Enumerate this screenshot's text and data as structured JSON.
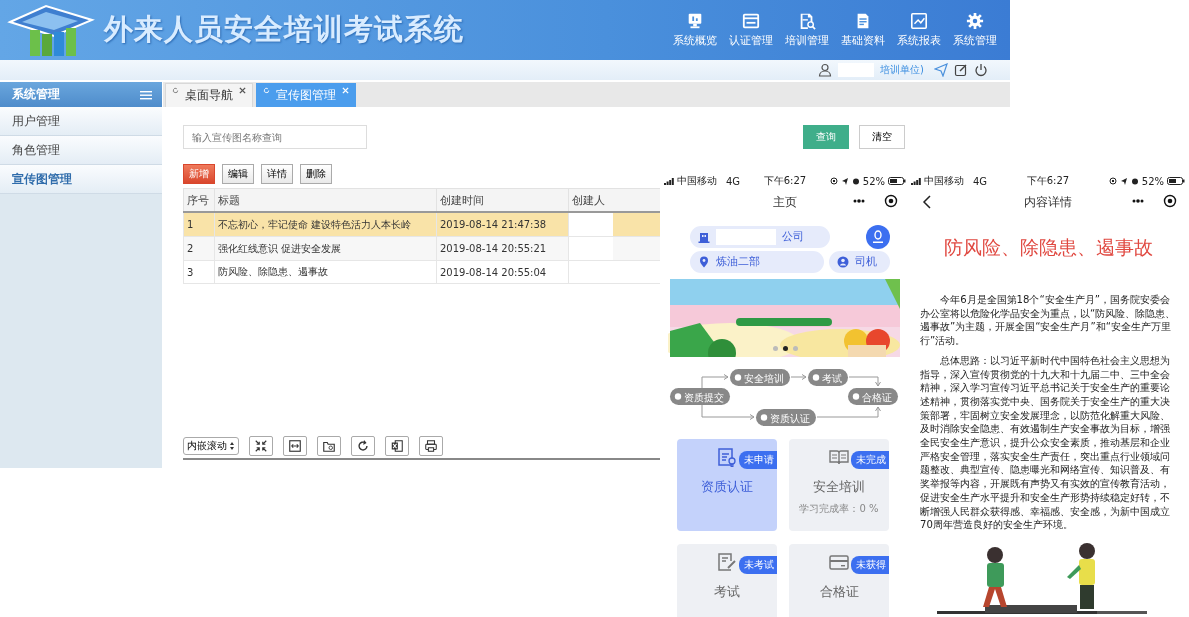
{
  "header": {
    "title": "外来人员安全培训考试系统",
    "nav": [
      {
        "label": "系统概览"
      },
      {
        "label": "认证管理"
      },
      {
        "label": "培训管理"
      },
      {
        "label": "基础资料"
      },
      {
        "label": "系统报表"
      },
      {
        "label": "系统管理"
      }
    ],
    "user_org": "培训单位)"
  },
  "sidebar": {
    "title": "系统管理",
    "items": [
      {
        "label": "用户管理",
        "selected": false
      },
      {
        "label": "角色管理",
        "selected": false
      },
      {
        "label": "宣传图管理",
        "selected": true
      }
    ]
  },
  "tabs": [
    {
      "label": "桌面导航",
      "selected": false
    },
    {
      "label": "宣传图管理",
      "selected": true
    }
  ],
  "search": {
    "placeholder": "输入宣传图名称查询"
  },
  "search_buttons": [
    "查询",
    "清空"
  ],
  "actions": [
    {
      "label": "新增",
      "kind": "primary"
    },
    {
      "label": "编辑",
      "kind": "plain"
    },
    {
      "label": "详情",
      "kind": "plain"
    },
    {
      "label": "删除",
      "kind": "plain"
    }
  ],
  "table": {
    "columns": [
      "序号",
      "标题",
      "创建时间",
      "创建人"
    ],
    "rows": [
      {
        "cells": [
          "1",
          "不忘初心，牢记使命 建设特色活力人本长岭",
          "2019-08-14 21:47:38"
        ],
        "selected": true,
        "creator_redacted": true
      },
      {
        "cells": [
          "2",
          "强化红线意识 促进安全发展",
          "2019-08-14 20:55:21"
        ],
        "selected": false,
        "creator_redacted": true
      },
      {
        "cells": [
          "3",
          "防风险、除隐患、遏事故",
          "2019-08-14 20:55:04"
        ],
        "selected": false,
        "creator_redacted": false
      }
    ]
  },
  "footer": {
    "scroll_mode": "内嵌滚动"
  },
  "phone_home": {
    "status": {
      "carrier": "中国移动",
      "network": "4G",
      "time": "下午6:27",
      "battery": "52%"
    },
    "title": "主页",
    "company": "公司",
    "location": "炼油二部",
    "role": "司机",
    "banner": {
      "kind": "picture",
      "dots": [
        {
          "selected": false
        },
        {
          "selected": true
        },
        {
          "selected": false
        }
      ]
    },
    "flow_steps": [
      "资质提交",
      "安全培训",
      "考试",
      "合格证",
      "资质认证"
    ],
    "cards": [
      {
        "title": "资质认证",
        "badge": "未申请",
        "selected": true
      },
      {
        "title": "安全培训",
        "badge": "未完成",
        "subtitle": "学习完成率：0 %",
        "selected": false
      },
      {
        "title": "考试",
        "badge": "未考试",
        "selected": false
      },
      {
        "title": "合格证",
        "badge": "未获得",
        "selected": false
      }
    ]
  },
  "phone_detail": {
    "status": {
      "carrier": "中国移动",
      "network": "4G",
      "time": "下午6:27",
      "battery": "52%"
    },
    "title": "内容详情",
    "heading": "防风险、除隐患、遏事故",
    "paragraphs": [
      "今年6月是全国第18个“安全生产月”，国务院安委会办公室将以危险化学品安全为重点，以“防风险、除隐患、遏事故”为主题，开展全国“安全生产月”和“安全生产万里行”活动。",
      "总体思路：以习近平新时代中国特色社会主义思想为指导，深入宣传贯彻党的十九大和十九届二中、三中全会精神，深入学习宣传习近平总书记关于安全生产的重要论述精神，贯彻落实党中央、国务院关于安全生产的重大决策部署，牢固树立安全发展理念，以防范化解重大风险、及时消除安全隐患、有效遏制生产安全事故为目标，增强全民安全生产意识，提升公众安全素质，推动基层和企业严格安全管理，落实安全生产责任，突出重点行业领域问题整改、典型宣传、隐患曝光和网络宣传、知识普及、有奖举报等内容，开展既有声势又有实效的宣传教育活动，促进安全生产水平提升和安全生产形势持续稳定好转，不断增强人民群众获得感、幸福感、安全感，为新中国成立70周年营造良好的安全生产环境。"
    ],
    "illustration": {
      "kind": "picture"
    }
  }
}
